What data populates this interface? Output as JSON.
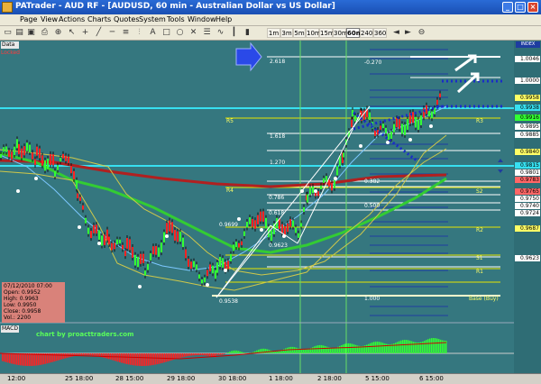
{
  "window": {
    "title": "PATrader - AUD RF - [AUDUSD, 60 min - Australian Dollar vs US Dollar]",
    "minimize": "_",
    "maximize": "□",
    "close": "×"
  },
  "menu": {
    "items": [
      "Page",
      "View",
      "Actions",
      "Charts",
      "Quotes",
      "System",
      "Tools",
      "Window",
      "Help"
    ]
  },
  "toolbar": {
    "timeframes": [
      "1m",
      "3m",
      "5m",
      "10m",
      "15m",
      "30m",
      "60m",
      "240",
      "360"
    ],
    "active_timeframe": "60m"
  },
  "chart": {
    "panel_label": "Data",
    "status": "Locked",
    "index_label": "INDEX",
    "credit": "chart by proacttraders.com",
    "macd_label": "MACD",
    "ohlc": {
      "date": "07/12/2010 07:00",
      "open": "Open: 0.9952",
      "high": "High: 0.9963",
      "low": "Low: 0.9950",
      "close": "Close: 0.9958",
      "vol": "Vol.: 2200"
    },
    "fib_labels_upper": [
      "2.618",
      "1.618",
      "1.270",
      "1.000"
    ],
    "fib_labels_mid": [
      "0.786",
      "0.618",
      "0.500",
      "0.382",
      "-0.270"
    ],
    "swing_labels": [
      "0.9699",
      "0.9623",
      "0.9538"
    ],
    "level_labels": [
      "R5",
      "R3",
      "R2",
      "R1",
      "R4",
      "S1",
      "S2",
      "Base (Buy)"
    ],
    "price_labels": [
      "1.0046",
      "1.0000",
      "0.9958",
      "0.9938",
      "0.9916",
      "0.9895",
      "0.9885",
      "0.9840",
      "0.9815",
      "0.9801",
      "0.9783",
      "0.9765",
      "0.9750",
      "0.9740",
      "0.9724",
      "0.9687",
      "0.9623"
    ],
    "colors": {
      "background": "#35777f",
      "bull": "#33ff33",
      "bear": "#ff2222",
      "fib_blue": "#1e3ca0",
      "ma_red": "#b02020",
      "ma_green": "#33cc33",
      "level_yellow": "#e6e600",
      "level_white": "#ffffff",
      "cyan_line": "#37e0f0"
    }
  },
  "timeaxis": {
    "labels": [
      "12:00",
      "25 18:00",
      "28 15:00",
      "29 18:00",
      "30 18:00",
      "1 18:00",
      "2 18:00",
      "5 15:00",
      "6 15:00"
    ]
  }
}
